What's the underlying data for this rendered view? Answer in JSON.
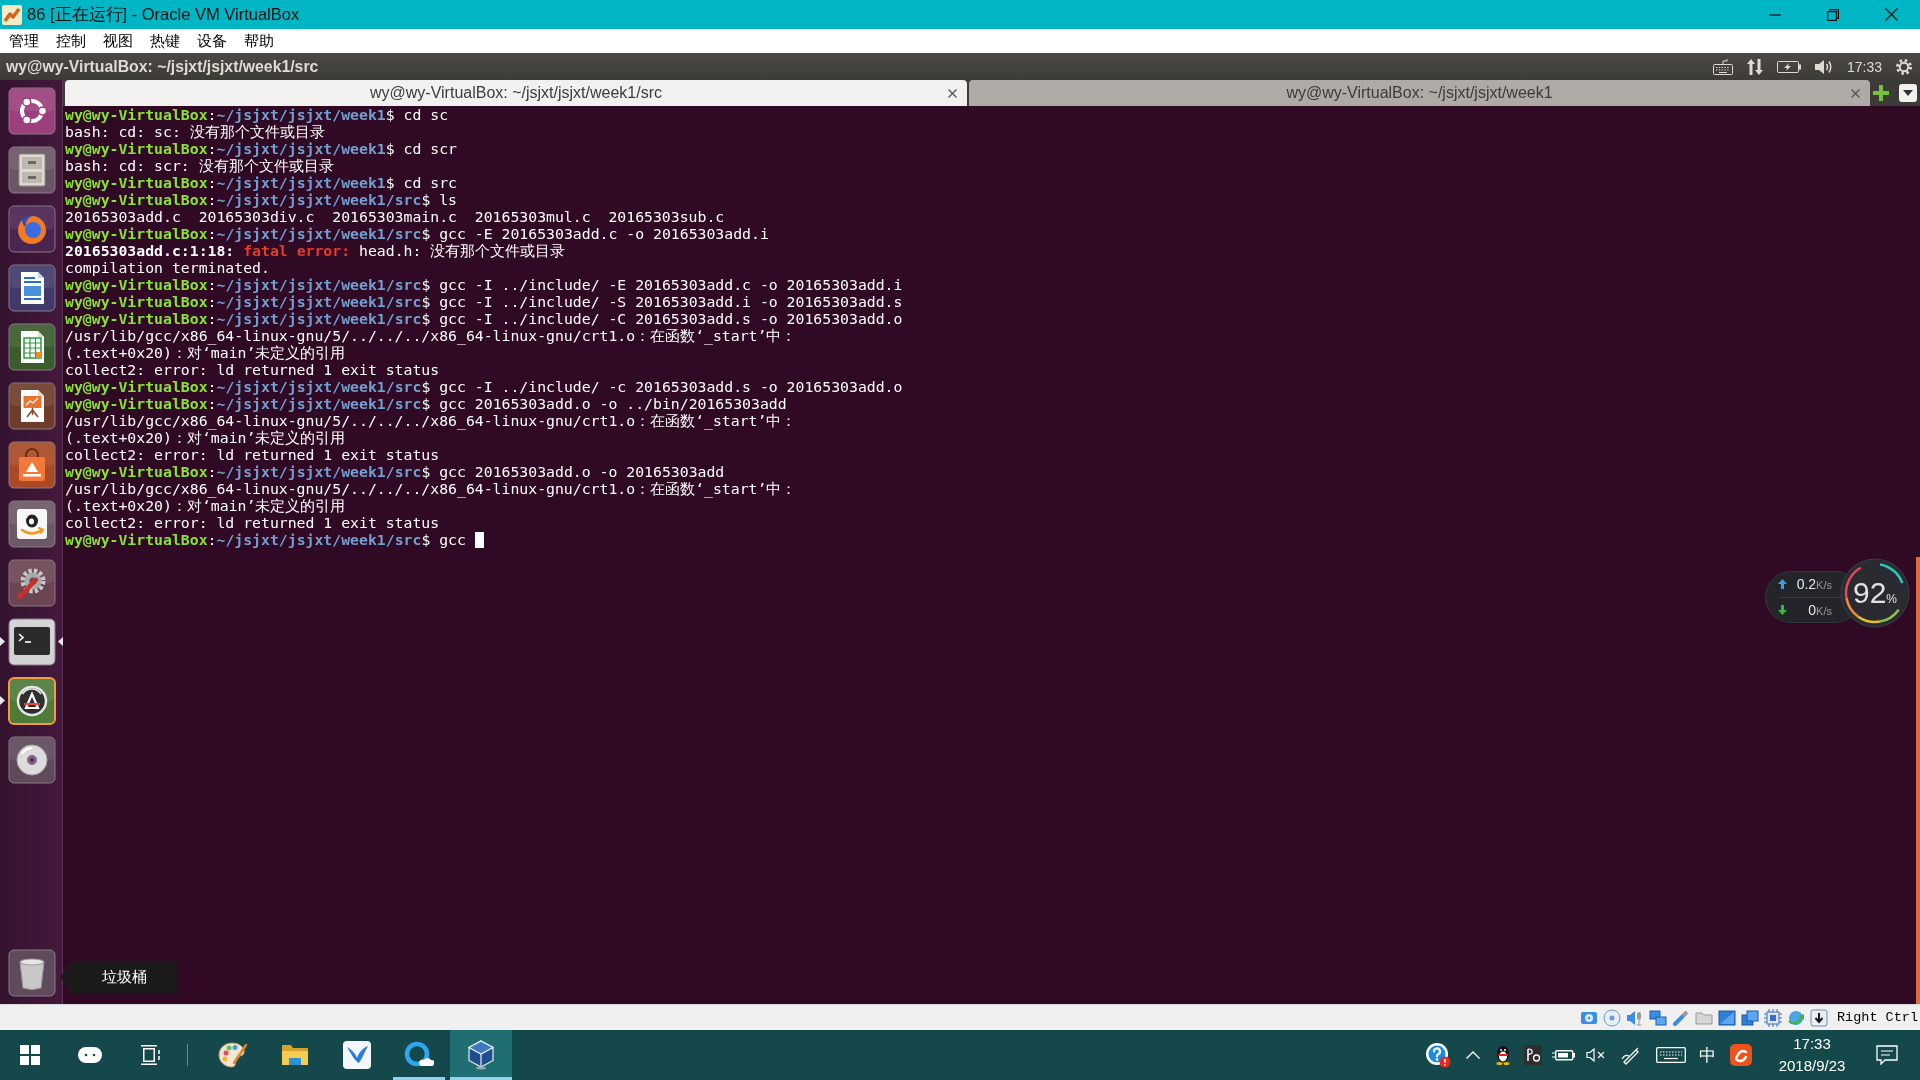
{
  "window": {
    "title": "86 [正在运行] - Oracle VM VirtualBox"
  },
  "menu": [
    "管理",
    "控制",
    "视图",
    "热键",
    "设备",
    "帮助"
  ],
  "top_panel": {
    "title": "wy@wy-VirtualBox: ~/jsjxt/jsjxt/week1/src",
    "clock": "17:33"
  },
  "launcher": {
    "items": [
      {
        "kind": "dash",
        "running": false,
        "focused": false,
        "urgent": false
      },
      {
        "kind": "files",
        "running": false,
        "focused": false,
        "urgent": false
      },
      {
        "kind": "browser",
        "running": false,
        "focused": false,
        "urgent": false
      },
      {
        "kind": "writer",
        "running": false,
        "focused": false,
        "urgent": false
      },
      {
        "kind": "calc",
        "running": false,
        "focused": false,
        "urgent": false
      },
      {
        "kind": "impress",
        "running": false,
        "focused": false,
        "urgent": false
      },
      {
        "kind": "store",
        "running": false,
        "focused": false,
        "urgent": false
      },
      {
        "kind": "shop",
        "running": false,
        "focused": false,
        "urgent": false
      },
      {
        "kind": "settings",
        "running": false,
        "focused": false,
        "urgent": false
      },
      {
        "kind": "terminal",
        "running": true,
        "focused": true,
        "urgent": false
      },
      {
        "kind": "updater",
        "running": true,
        "focused": false,
        "urgent": true
      },
      {
        "kind": "disc",
        "running": false,
        "focused": false,
        "urgent": false
      }
    ],
    "trash": {
      "tooltip": "垃圾桶"
    }
  },
  "terminal": {
    "tabs": [
      {
        "label": "wy@wy-VirtualBox: ~/jsjxt/jsjxt/week1/src",
        "selected": true
      },
      {
        "label": "wy@wy-VirtualBox: ~/jsjxt/jsjxt/week1",
        "selected": false
      }
    ],
    "lines": [
      {
        "kind": "prompt",
        "user_host": "wy@wy-VirtualBox",
        "separator": ":",
        "path": "~/jsjxt/jsjxt/week1",
        "command": "$ cd sc"
      },
      {
        "kind": "output",
        "text": "bash: cd: sc: 没有那个文件或目录"
      },
      {
        "kind": "prompt",
        "user_host": "wy@wy-VirtualBox",
        "separator": ":",
        "path": "~/jsjxt/jsjxt/week1",
        "command": "$ cd scr"
      },
      {
        "kind": "output",
        "text": "bash: cd: scr: 没有那个文件或目录"
      },
      {
        "kind": "prompt",
        "user_host": "wy@wy-VirtualBox",
        "separator": ":",
        "path": "~/jsjxt/jsjxt/week1",
        "command": "$ cd src"
      },
      {
        "kind": "prompt",
        "user_host": "wy@wy-VirtualBox",
        "separator": ":",
        "path": "~/jsjxt/jsjxt/week1/src",
        "command": "$ ls"
      },
      {
        "kind": "output",
        "text": "20165303add.c  20165303div.c  20165303main.c  20165303mul.c  20165303sub.c"
      },
      {
        "kind": "prompt",
        "user_host": "wy@wy-VirtualBox",
        "separator": ":",
        "path": "~/jsjxt/jsjxt/week1/src",
        "command": "$ gcc -E 20165303add.c -o 20165303add.i"
      },
      {
        "kind": "diagnostic",
        "location": "20165303add.c:1:18:",
        "severity": "fatal error:",
        "message": "head.h: 没有那个文件或目录"
      },
      {
        "kind": "output",
        "text": "compilation terminated."
      },
      {
        "kind": "prompt",
        "user_host": "wy@wy-VirtualBox",
        "separator": ":",
        "path": "~/jsjxt/jsjxt/week1/src",
        "command": "$ gcc -I ../include/ -E 20165303add.c -o 20165303add.i"
      },
      {
        "kind": "prompt",
        "user_host": "wy@wy-VirtualBox",
        "separator": ":",
        "path": "~/jsjxt/jsjxt/week1/src",
        "command": "$ gcc -I ../include/ -S 20165303add.i -o 20165303add.s"
      },
      {
        "kind": "prompt",
        "user_host": "wy@wy-VirtualBox",
        "separator": ":",
        "path": "~/jsjxt/jsjxt/week1/src",
        "command": "$ gcc -I ../include/ -C 20165303add.s -o 20165303add.o"
      },
      {
        "kind": "output",
        "text": "/usr/lib/gcc/x86_64-linux-gnu/5/../../../x86_64-linux-gnu/crt1.o：在函数‘_start’中："
      },
      {
        "kind": "output",
        "text": "(.text+0x20)：对‘main’未定义的引用"
      },
      {
        "kind": "output",
        "text": "collect2: error: ld returned 1 exit status"
      },
      {
        "kind": "prompt",
        "user_host": "wy@wy-VirtualBox",
        "separator": ":",
        "path": "~/jsjxt/jsjxt/week1/src",
        "command": "$ gcc -I ../include/ -c 20165303add.s -o 20165303add.o"
      },
      {
        "kind": "prompt",
        "user_host": "wy@wy-VirtualBox",
        "separator": ":",
        "path": "~/jsjxt/jsjxt/week1/src",
        "command": "$ gcc 20165303add.o -o ../bin/20165303add"
      },
      {
        "kind": "output",
        "text": "/usr/lib/gcc/x86_64-linux-gnu/5/../../../x86_64-linux-gnu/crt1.o：在函数‘_start’中："
      },
      {
        "kind": "output",
        "text": "(.text+0x20)：对‘main’未定义的引用"
      },
      {
        "kind": "output",
        "text": "collect2: error: ld returned 1 exit status"
      },
      {
        "kind": "prompt",
        "user_host": "wy@wy-VirtualBox",
        "separator": ":",
        "path": "~/jsjxt/jsjxt/week1/src",
        "command": "$ gcc 20165303add.o -o 20165303add"
      },
      {
        "kind": "output",
        "text": "/usr/lib/gcc/x86_64-linux-gnu/5/../../../x86_64-linux-gnu/crt1.o：在函数‘_start’中："
      },
      {
        "kind": "output",
        "text": "(.text+0x20)：对‘main’未定义的引用"
      },
      {
        "kind": "output",
        "text": "collect2: error: ld returned 1 exit status"
      },
      {
        "kind": "prompt",
        "user_host": "wy@wy-VirtualBox",
        "separator": ":",
        "path": "~/jsjxt/jsjxt/week1/src",
        "command": "$ gcc"
      }
    ],
    "cursor": true
  },
  "net_monitor": {
    "upload": {
      "value": "0.2",
      "unit": "K/s"
    },
    "download": {
      "value": "0",
      "unit": "K/s"
    },
    "usage": {
      "value": "92",
      "unit": "%"
    }
  },
  "status_bar": {
    "host_key": "Right Ctrl"
  },
  "taskbar": {
    "apps": [
      {
        "kind": "paint",
        "running": false,
        "selected": false
      },
      {
        "kind": "explorer",
        "running": false,
        "selected": false
      },
      {
        "kind": "bird",
        "running": false,
        "selected": false
      },
      {
        "kind": "browser",
        "running": true,
        "selected": false
      },
      {
        "kind": "virtualbox",
        "running": true,
        "selected": true
      }
    ],
    "tray": {
      "ime": "中",
      "time": "17:33",
      "date": "2018/9/23"
    }
  }
}
